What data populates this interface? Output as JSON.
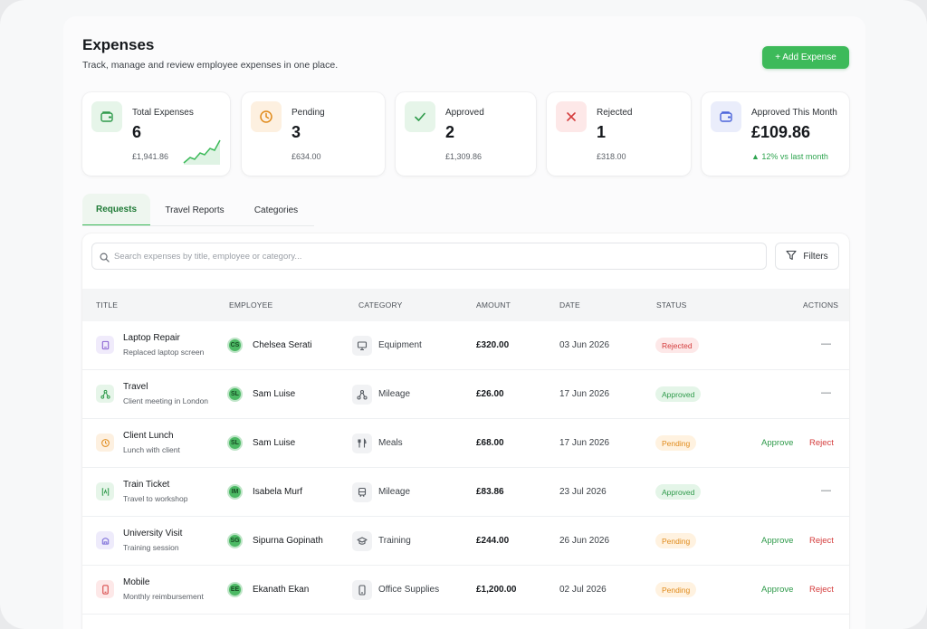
{
  "header": {
    "title": "Expenses",
    "subtitle": "Track, manage and review employee expenses in one place.",
    "add_label": "+ Add Expense"
  },
  "cards": [
    {
      "label": "Total Expenses",
      "value": "6",
      "sub": "£1,941.86",
      "icon": "wallet-icon",
      "color": "#3dba5a"
    },
    {
      "label": "Pending",
      "value": "3",
      "sub": "£634.00",
      "icon": "clock-icon",
      "color": "#e08a1a"
    },
    {
      "label": "Approved",
      "value": "2",
      "sub": "£1,309.86",
      "icon": "check-icon",
      "color": "#3dba5a"
    },
    {
      "label": "Rejected",
      "value": "1",
      "sub": "£318.00",
      "icon": "x-icon",
      "color": "#d43b3b"
    },
    {
      "label": "Approved This Month",
      "value": "£109.86",
      "trend": "▲ 12% vs last month",
      "icon": "wallet-icon",
      "color": "#4a63d9"
    }
  ],
  "tabs": [
    "Requests",
    "Travel Reports",
    "Categories"
  ],
  "active_tab": "Requests",
  "search": {
    "placeholder": "Search expenses by title, employee or category..."
  },
  "filters_label": "Filters",
  "columns": [
    "TITLE",
    "EMPLOYEE",
    "CATEGORY",
    "AMOUNT",
    "DATE",
    "STATUS",
    "ACTIONS"
  ],
  "rows": [
    {
      "title": "Laptop Repair",
      "desc": "Replaced laptop screen",
      "initials": "CS",
      "employee": "Chelsea Serati",
      "category": "Equipment",
      "amount": "£320.00",
      "date": "03 Jun 2026",
      "status": "Rejected",
      "icon": "laptop-icon",
      "cat_icon": "monitor-icon"
    },
    {
      "title": "Travel",
      "desc": "Client meeting in London",
      "initials": "SL",
      "employee": "Sam Luise",
      "category": "Mileage",
      "amount": "£26.00",
      "date": "17 Jun 2026",
      "status": "Approved",
      "icon": "route-icon",
      "cat_icon": "route-icon"
    },
    {
      "title": "Client Lunch",
      "desc": "Lunch with client",
      "initials": "SL",
      "employee": "Sam Luise",
      "category": "Meals",
      "amount": "£68.00",
      "date": "17 Jun 2026",
      "status": "Pending",
      "icon": "receipt-icon",
      "cat_icon": "cutlery-icon"
    },
    {
      "title": "Train Ticket",
      "desc": "Travel to workshop",
      "initials": "IM",
      "employee": "Isabela Murf",
      "category": "Mileage",
      "amount": "£83.86",
      "date": "23 Jul 2026",
      "status": "Approved",
      "icon": "ticket-icon",
      "cat_icon": "train-icon"
    },
    {
      "title": "University Visit",
      "desc": "Training session",
      "initials": "SG",
      "employee": "Sipurna Gopinath",
      "category": "Training",
      "amount": "£244.00",
      "date": "26 Jun 2026",
      "status": "Pending",
      "icon": "university-icon",
      "cat_icon": "graduation-cap-icon"
    },
    {
      "title": "Mobile",
      "desc": "Monthly reimbursement",
      "initials": "EE",
      "employee": "Ekanath Ekan",
      "category": "Office Supplies",
      "amount": "£1,200.00",
      "date": "02 Jul 2026",
      "status": "Pending",
      "icon": "phone-icon",
      "cat_icon": "phone-icon"
    }
  ],
  "actions": {
    "approve": "Approve",
    "reject": "Reject",
    "none": "—"
  },
  "row_icon_colors": [
    "#8a63d2",
    "#3dba5a",
    "#e08a1a",
    "#3dba5a",
    "#7a6ad8",
    "#d43b3b"
  ]
}
